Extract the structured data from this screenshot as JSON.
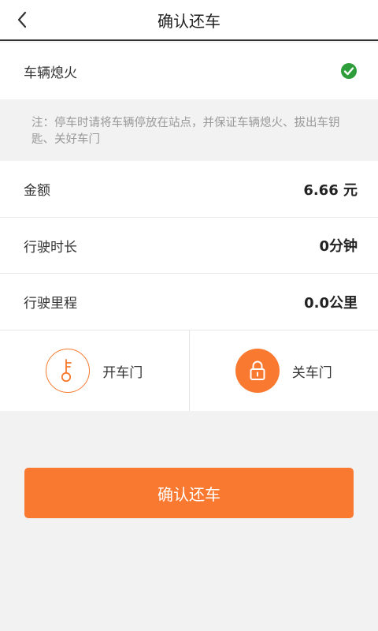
{
  "header": {
    "title": "确认还车",
    "back_icon": "chevron-left-icon"
  },
  "engine_status": {
    "label": "车辆熄火",
    "checked": true,
    "check_color": "#2e9e3a"
  },
  "note": {
    "text": "注：停车时请将车辆停放在站点，并保证车辆熄火、拔出车钥匙、关好车门"
  },
  "summary": {
    "amount_label": "金额",
    "amount_value": "6.66 元",
    "duration_label": "行驶时长",
    "duration_value": "0分钟",
    "distance_label": "行驶里程",
    "distance_value": "0.0公里"
  },
  "doors": {
    "open_label": "开车门",
    "open_icon": "key-icon",
    "close_label": "关车门",
    "close_icon": "lock-icon"
  },
  "confirm_button": {
    "label": "确认还车"
  },
  "colors": {
    "accent": "#f8792f",
    "success": "#2e9e3a"
  }
}
